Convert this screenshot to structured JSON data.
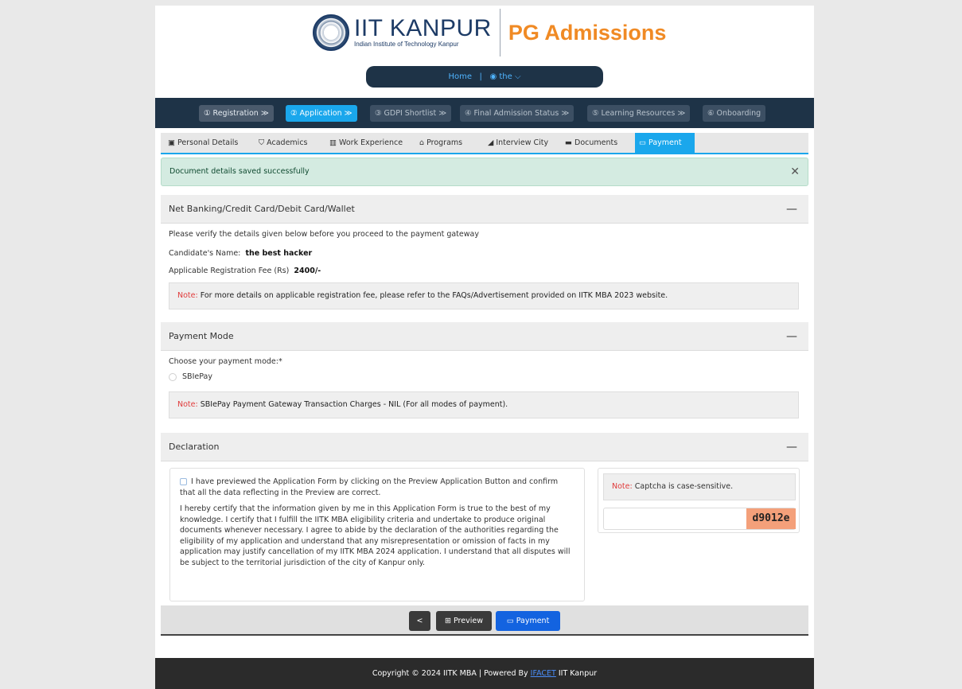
{
  "header": {
    "logo_main": "IIT KANPUR",
    "logo_sub": "Indian Institute of Technology Kanpur",
    "portal_title": "PG Admissions",
    "nav_home": "Home",
    "nav_sep": "|",
    "nav_user": "the",
    "user_icon": "user-circle-icon",
    "chevron_icon": "chevron-down-icon"
  },
  "steps": [
    {
      "label": "① Registration  ≫"
    },
    {
      "label": "② Application  ≫"
    },
    {
      "label": "③ GDPI Shortlist  ≫"
    },
    {
      "label": "④ Final Admission Status  ≫"
    },
    {
      "label": "⑤ Learning Resources  ≫"
    },
    {
      "label": "⑥ Onboarding"
    }
  ],
  "tabs": [
    {
      "label": "Personal Details",
      "icon": "id-card-icon"
    },
    {
      "label": "Academics",
      "icon": "graduation-cap-icon"
    },
    {
      "label": "Work Experience",
      "icon": "building-icon"
    },
    {
      "label": "Programs",
      "icon": "institution-icon"
    },
    {
      "label": "Interview City",
      "icon": "city-icon"
    },
    {
      "label": "Documents",
      "icon": "folder-icon"
    },
    {
      "label": "Payment",
      "icon": "credit-card-icon"
    }
  ],
  "alert": {
    "text": "Document details saved successfully",
    "close": "✕"
  },
  "section_payment_gateway": {
    "title": "Net Banking/Credit Card/Debit Card/Wallet",
    "toggle": "—",
    "instruction": "Please verify the details given below before you proceed to the payment gateway",
    "candidate_label": "Candidate's Name:",
    "candidate_value": "the best hacker",
    "fee_label": "Applicable Registration Fee (Rs)",
    "fee_value": "2400/-",
    "note_label": "Note:",
    "note_text": "For more details on applicable registration fee, please refer to the FAQs/Advertisement provided on IITK MBA 2023 website."
  },
  "section_payment_mode": {
    "title": "Payment Mode",
    "toggle": "—",
    "choose_label": "Choose your payment mode:*",
    "option_sbiepay": "SBIePay",
    "note_label": "Note:",
    "note_text": "SBIePay Payment Gateway Transaction Charges - NIL (For all modes of payment)."
  },
  "section_declaration": {
    "title": "Declaration",
    "toggle": "—",
    "para1": "I have previewed the Application Form by clicking on the Preview Application Button and confirm that all the data reflecting in the Preview are correct.",
    "para2": "I hereby certify that the information given by me in this Application Form is true to the best of my knowledge. I certify that I fulfill the IITK MBA eligibility criteria and undertake to produce original documents whenever necessary. I agree to abide by the declaration of the authorities regarding the eligibility of my application and understand that any misrepresentation or omission of facts in my application may justify cancellation of my IITK MBA 2024 application. I understand that all disputes will be subject to the territorial jurisdiction of the city of Kanpur only.",
    "captcha_note_label": "Note:",
    "captcha_note_text": "Captcha is case-sensitive.",
    "captcha_value": "",
    "captcha_code": "d9012e"
  },
  "actions": {
    "back": "<",
    "preview": "Preview",
    "payment": "Payment"
  },
  "footer": {
    "prefix": "Copyright © 2024 IITK MBA | Powered By",
    "link": "IFACET",
    "suffix": "IIT Kanpur"
  }
}
